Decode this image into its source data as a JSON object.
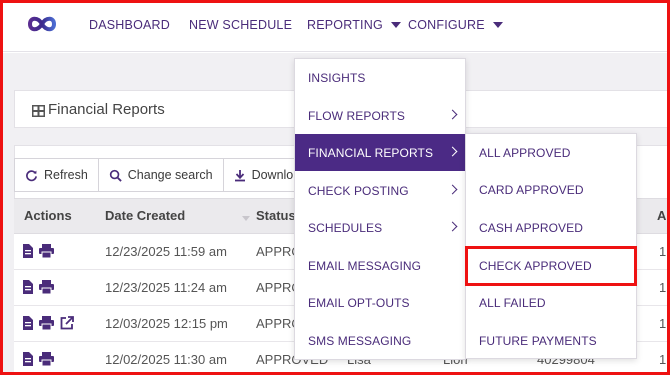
{
  "nav": {
    "items": [
      {
        "label": "DASHBOARD"
      },
      {
        "label": "NEW SCHEDULE"
      },
      {
        "label": "REPORTING"
      },
      {
        "label": "CONFIGURE"
      }
    ]
  },
  "panel": {
    "title": "Financial Reports"
  },
  "toolbar": {
    "refresh": "Refresh",
    "change_search": "Change search",
    "download": "Downlo"
  },
  "table": {
    "columns": [
      "Actions",
      "Date Created",
      "Status"
    ],
    "edge_col": "A",
    "rows": [
      {
        "date": "12/23/2025 11:59 am",
        "status": "APPRO",
        "tail": "1"
      },
      {
        "date": "12/23/2025 11:24 am",
        "status": "APPRO",
        "tail": "1"
      },
      {
        "date": "12/03/2025 12:15 pm",
        "status": "APPRO",
        "tail": "1"
      },
      {
        "date": "12/02/2025 11:30 am",
        "status": "APPROVED",
        "first": "Lisa",
        "last": "Lion",
        "account": "40299804",
        "tail": "1"
      }
    ]
  },
  "reporting_menu": {
    "items": [
      {
        "label": "INSIGHTS"
      },
      {
        "label": "FLOW REPORTS"
      },
      {
        "label": "FINANCIAL REPORTS"
      },
      {
        "label": "CHECK POSTING"
      },
      {
        "label": "SCHEDULES"
      },
      {
        "label": "EMAIL MESSAGING"
      },
      {
        "label": "EMAIL OPT-OUTS"
      },
      {
        "label": "SMS MESSAGING"
      }
    ]
  },
  "financial_submenu": {
    "items": [
      {
        "label": "ALL APPROVED"
      },
      {
        "label": "CARD APPROVED"
      },
      {
        "label": "CASH APPROVED"
      },
      {
        "label": "CHECK APPROVED"
      },
      {
        "label": "ALL FAILED"
      },
      {
        "label": "FUTURE PAYMENTS"
      }
    ]
  },
  "colors": {
    "brand": "#4a2c7a",
    "active_menu": "#4b2a85",
    "highlight": "#ee1111"
  }
}
